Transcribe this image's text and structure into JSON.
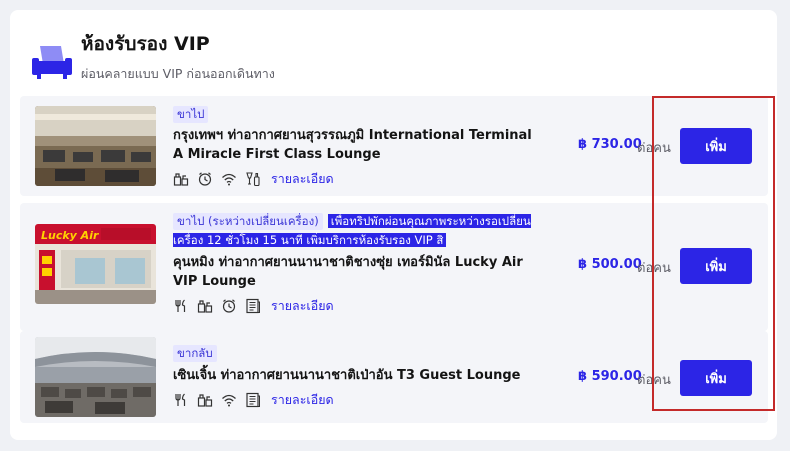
{
  "header": {
    "title": "ห้องรับรอง VIP",
    "subtitle": "ผ่อนคลายแบบ VIP ก่อนออกเดินทาง",
    "icon": "lounge-sofa-icon"
  },
  "colors": {
    "accent": "#2c25e6",
    "tag_bg": "#e6e6ff",
    "row_bg": "#f4f5f9",
    "highlight_border": "#c42a2a"
  },
  "lounges": [
    {
      "tag": "ขาไป",
      "promo": "",
      "name": "กรุงเทพฯ ท่าอากาศยานสุวรรณภูมิ International Terminal A Miracle First Class Lounge",
      "amenities": [
        "food-drink-icon",
        "clock-icon",
        "wifi-icon",
        "alcohol-icon"
      ],
      "details_label": "รายละเอียด",
      "price": "฿ 730.00",
      "per_label": "ต่อคน",
      "button_label": "เพิ่ม"
    },
    {
      "tag": "ขาไป (ระหว่างเปลี่ยนเครื่อง)",
      "promo": "เพื่อทริปพักผ่อนคุณภาพระหว่างรอเปลี่ยนเครื่อง 12 ชั่วโมง 15 นาที เพิ่มบริการห้องรับรอง VIP สิ",
      "name": "คุนหมิง ท่าอากาศยานนานาชาติชางซุ่ย เทอร์มินัล Lucky Air VIP Lounge",
      "amenities": [
        "cutlery-icon",
        "food-drink-icon",
        "clock-icon",
        "newspaper-icon"
      ],
      "details_label": "รายละเอียด",
      "price": "฿ 500.00",
      "per_label": "ต่อคน",
      "button_label": "เพิ่ม"
    },
    {
      "tag": "ขากลับ",
      "promo": "",
      "name": "เซินเจิ้น ท่าอากาศยานนานาชาติเป่าอัน T3 Guest Lounge",
      "amenities": [
        "cutlery-icon",
        "food-drink-icon",
        "wifi-icon",
        "newspaper-icon"
      ],
      "details_label": "รายละเอียด",
      "price": "฿ 590.00",
      "per_label": "ต่อคน",
      "button_label": "เพิ่ม"
    }
  ]
}
